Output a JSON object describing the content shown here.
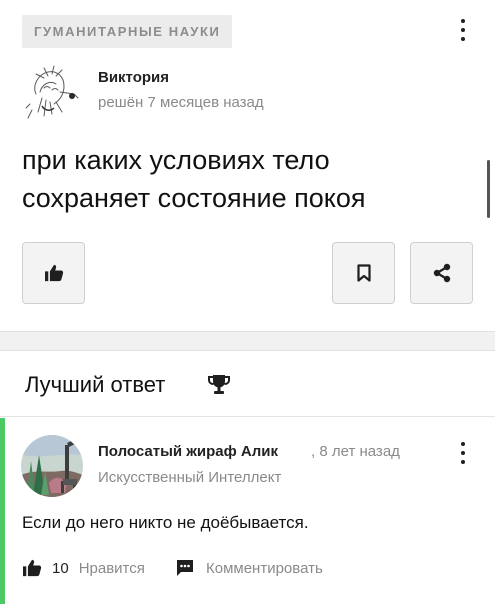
{
  "question": {
    "subject": "ГУМАНИТАРНЫЕ НАУКИ",
    "author": "Виктория",
    "status": "решён 7 месяцев назад",
    "text": "при каких условиях тело сохраняет состояние покоя",
    "icons": {
      "like": "thumb-up-icon",
      "save": "bookmark-icon",
      "share": "share-icon",
      "menu": "more-vertical-icon"
    }
  },
  "best_answer": {
    "title": "Лучший ответ",
    "author": "Полосатый жираф Алик",
    "time": ", 8 лет назад",
    "rank": "Искусственный Интеллект",
    "text": "Если до него никто не доёбывается.",
    "likes": "10",
    "like_label": "Нравится",
    "comment_label": "Комментировать",
    "icons": {
      "title": "trophy-icon",
      "like": "thumb-up-icon",
      "comment": "comment-icon",
      "menu": "more-vertical-icon"
    }
  },
  "colors": {
    "accent": "#4cc864",
    "muted_text": "#8a8a8a",
    "button_bg": "#f3f3f3"
  }
}
